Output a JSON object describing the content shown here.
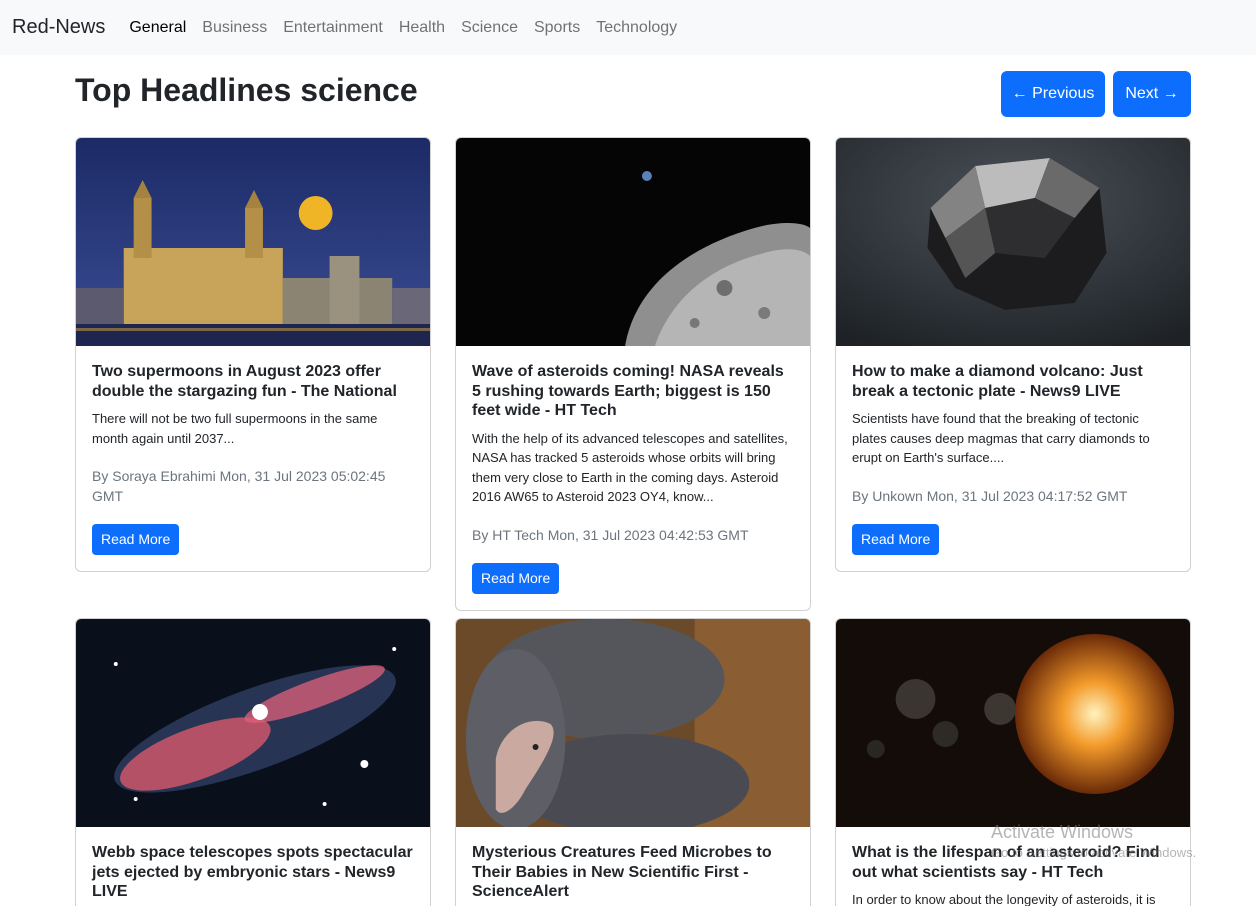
{
  "navbar": {
    "brand": "Red-News",
    "links": [
      "General",
      "Business",
      "Entertainment",
      "Health",
      "Science",
      "Sports",
      "Technology"
    ]
  },
  "page": {
    "title": "Top Headlines science",
    "prev_label": "← Previous",
    "next_label": "Next →"
  },
  "articles": [
    {
      "title": "Two supermoons in August 2023 offer double the stargazing fun - The National",
      "description": "There will not be two full supermoons in the same month again until 2037...",
      "meta": "By Soraya Ebrahimi Mon, 31 Jul 2023 05:02:45 GMT",
      "button": "Read More",
      "image_icon": "city-night-moon-image"
    },
    {
      "title": "Wave of asteroids coming! NASA reveals 5 rushing towards Earth; biggest is 150 feet wide - HT Tech",
      "description": "With the help of its advanced telescopes and satellites, NASA has tracked 5 asteroids whose orbits will bring them very close to Earth in the coming days. Asteroid 2016 AW65 to Asteroid 2023 OY4, know...",
      "meta": "By HT Tech Mon, 31 Jul 2023 04:42:53 GMT",
      "button": "Read More",
      "image_icon": "asteroid-image"
    },
    {
      "title": "How to make a diamond volcano: Just break a tectonic plate - News9 LIVE",
      "description": "Scientists have found that the breaking of tectonic plates causes deep magmas that carry diamonds to erupt on Earth's surface....",
      "meta": "By Unkown Mon, 31 Jul 2023 04:17:52 GMT",
      "button": "Read More",
      "image_icon": "diamond-rock-image"
    },
    {
      "title": "Webb space telescopes spots spectacular jets ejected by embryonic stars - News9 LIVE",
      "image_icon": "nebula-jets-image"
    },
    {
      "title": "Mysterious Creatures Feed Microbes to Their Babies in New Scientific First - ScienceAlert",
      "image_icon": "caecilian-image"
    },
    {
      "title": "What is the lifespan of an asteroid? Find out what scientists say - HT Tech",
      "description": "In order to know about the longevity of asteroids, it is",
      "image_icon": "exploding-planet-image"
    }
  ],
  "watermark": {
    "title": "Activate Windows",
    "subtitle": "Go to Settings to activate Windows."
  },
  "colors": {
    "primary": "#0d6efd",
    "navbar_bg": "#f8f9fa",
    "muted": "#6c757d"
  }
}
